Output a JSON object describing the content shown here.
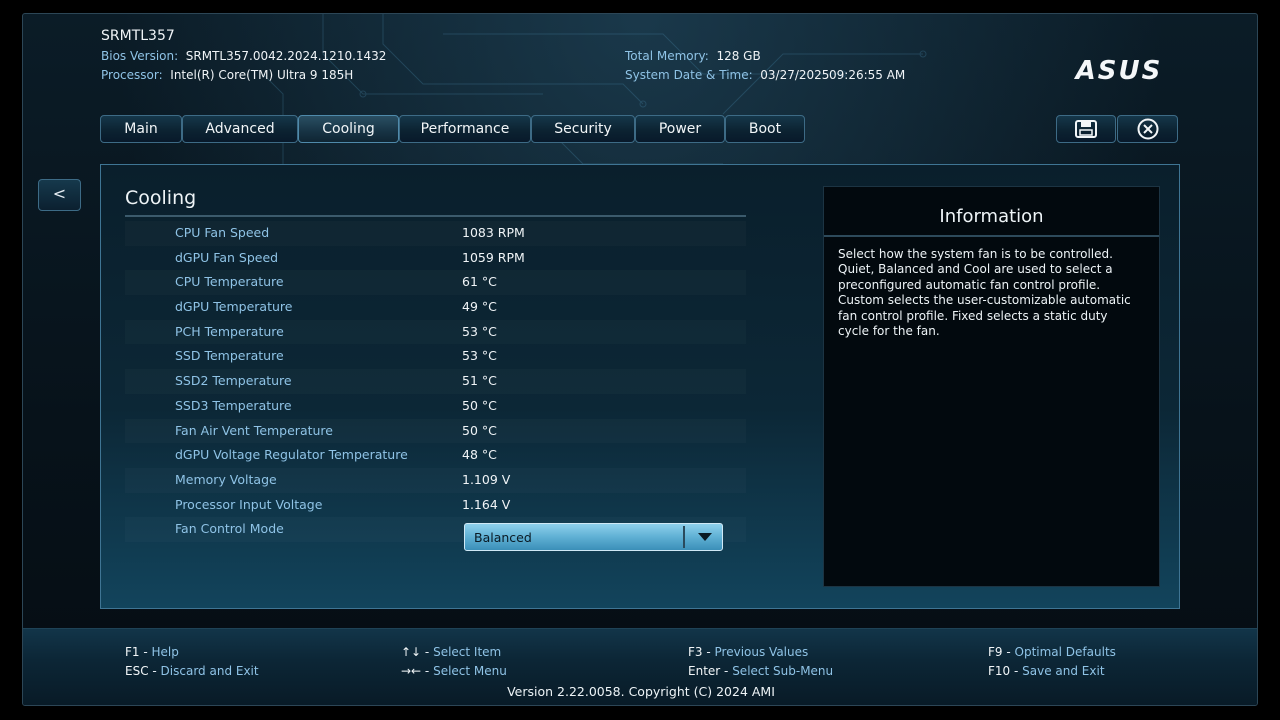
{
  "header": {
    "model": "SRMTL357",
    "bios_version_label": "Bios Version:",
    "bios_version": "SRMTL357.0042.2024.1210.1432",
    "processor_label": "Processor:",
    "processor": "Intel(R) Core(TM) Ultra 9 185H",
    "total_memory_label": "Total Memory:",
    "total_memory": "128 GB",
    "datetime_label": "System Date & Time:",
    "date": "03/27/2025",
    "time": "09:26:55 AM",
    "logo_text": "ASUS"
  },
  "tabs": [
    {
      "label": "Main",
      "active": false
    },
    {
      "label": "Advanced",
      "active": false
    },
    {
      "label": "Cooling",
      "active": true
    },
    {
      "label": "Performance",
      "active": false
    },
    {
      "label": "Security",
      "active": false
    },
    {
      "label": "Power",
      "active": false
    },
    {
      "label": "Boot",
      "active": false
    }
  ],
  "toolbar": {
    "save_icon": "save-icon",
    "exit_icon": "close-circle-icon"
  },
  "back_label": "<",
  "panel": {
    "title": "Cooling",
    "rows": [
      {
        "name": "CPU Fan Speed",
        "value": "1083 RPM"
      },
      {
        "name": "dGPU Fan Speed",
        "value": "1059 RPM"
      },
      {
        "name": "CPU Temperature",
        "value": "61 °C"
      },
      {
        "name": "dGPU Temperature",
        "value": "49 °C"
      },
      {
        "name": "PCH Temperature",
        "value": "53 °C"
      },
      {
        "name": "SSD Temperature",
        "value": "53 °C"
      },
      {
        "name": "SSD2 Temperature",
        "value": "51 °C"
      },
      {
        "name": "SSD3 Temperature",
        "value": "50 °C"
      },
      {
        "name": "Fan Air Vent Temperature",
        "value": "50 °C"
      },
      {
        "name": "dGPU Voltage Regulator Temperature",
        "value": "48 °C"
      },
      {
        "name": "Memory Voltage",
        "value": "1.109 V"
      },
      {
        "name": "Processor Input Voltage",
        "value": "1.164 V"
      },
      {
        "name": "Fan Control Mode",
        "value": ""
      }
    ],
    "fan_control_mode": "Balanced"
  },
  "info": {
    "title": "Information",
    "text": "Select how the system fan is to be controlled. Quiet, Balanced and Cool are used to select a preconfigured automatic fan control profile. Custom selects the user-customizable automatic fan control profile. Fixed selects a static duty cycle for the fan."
  },
  "footer": {
    "f1_key": "F1",
    "f1_desc": "Help",
    "esc_key": "ESC",
    "esc_desc": "Discard and Exit",
    "updown_key": "↑↓",
    "updown_desc": "Select Item",
    "leftright_key": "→←",
    "leftright_desc": "Select Menu",
    "f3_key": "F3",
    "f3_desc": "Previous Values",
    "enter_key": "Enter",
    "enter_desc": "Select Sub-Menu",
    "f9_key": "F9",
    "f9_desc": "Optimal Defaults",
    "f10_key": "F10",
    "f10_desc": "Save and Exit",
    "copyright": "Version 2.22.0058. Copyright (C) 2024 AMI"
  },
  "colors": {
    "accent": "#8fc3e6",
    "panel_border": "#3f7594",
    "dropdown": "#5fb0d4"
  }
}
